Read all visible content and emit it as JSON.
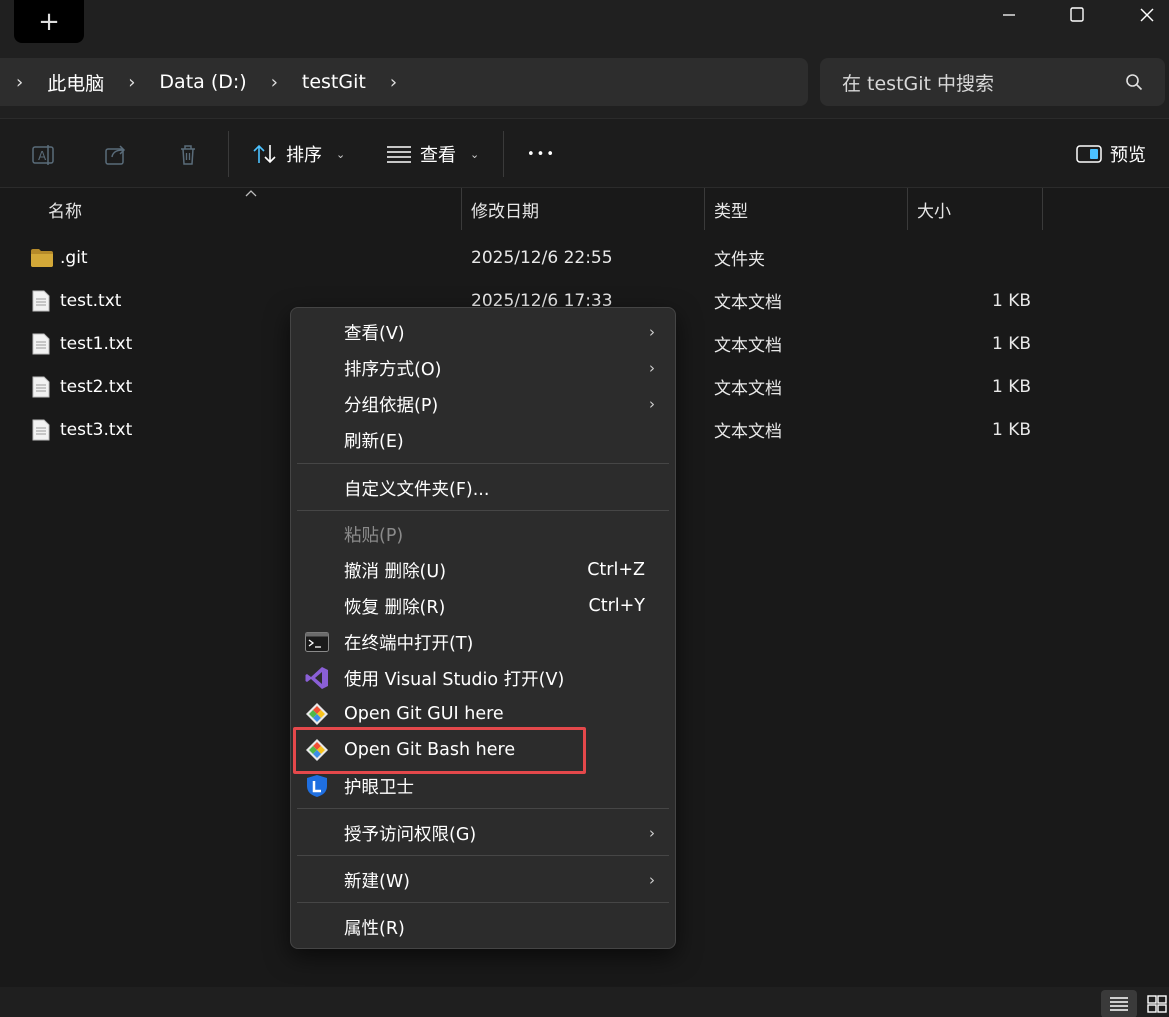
{
  "titlebar": {
    "new_tab_symbol": "+"
  },
  "address": {
    "crumbs": [
      "此电脑",
      "Data (D:)",
      "testGit"
    ],
    "search_placeholder": "在 testGit 中搜索"
  },
  "toolbar": {
    "sort_label": "排序",
    "view_label": "查看",
    "more_label": "•••",
    "preview_label": "预览"
  },
  "columns": {
    "name": "名称",
    "date": "修改日期",
    "type": "类型",
    "size": "大小"
  },
  "files": [
    {
      "name": ".git",
      "date": "2025/12/6 22:55",
      "type": "文件夹",
      "size": "",
      "icon": "folder-icon"
    },
    {
      "name": "test.txt",
      "date": "2025/12/6 17:33",
      "type": "文本文档",
      "size": "1 KB",
      "icon": "text-file-icon"
    },
    {
      "name": "test1.txt",
      "date": "",
      "type": "文本文档",
      "size": "1 KB",
      "icon": "text-file-icon"
    },
    {
      "name": "test2.txt",
      "date": "",
      "type": "文本文档",
      "size": "1 KB",
      "icon": "text-file-icon"
    },
    {
      "name": "test3.txt",
      "date": "",
      "type": "文本文档",
      "size": "1 KB",
      "icon": "text-file-icon"
    }
  ],
  "context_menu": {
    "view": "查看(V)",
    "sort_by": "排序方式(O)",
    "group_by": "分组依据(P)",
    "refresh": "刷新(E)",
    "customize": "自定义文件夹(F)...",
    "paste": "粘贴(P)",
    "undo": "撤消 删除(U)",
    "undo_shortcut": "Ctrl+Z",
    "redo": "恢复 删除(R)",
    "redo_shortcut": "Ctrl+Y",
    "terminal": "在终端中打开(T)",
    "visual_studio": "使用 Visual Studio 打开(V)",
    "git_gui": "Open Git GUI here",
    "git_bash": "Open Git Bash here",
    "eye_guard": "护眼卫士",
    "grant_access": "授予访问权限(G)",
    "new": "新建(W)",
    "properties": "属性(R)",
    "submenu_arrow": "›"
  },
  "colors": {
    "background": "#191919",
    "menu_bg": "#2c2c2c",
    "highlight_border": "#e4484b",
    "accent": "#4cc2ff",
    "folder": "#d3a838"
  }
}
